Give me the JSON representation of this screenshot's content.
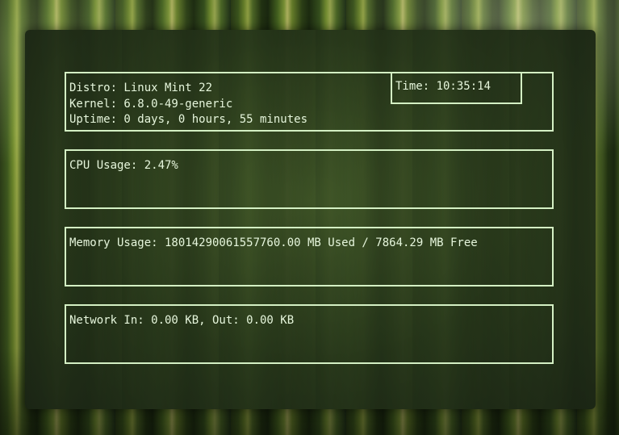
{
  "system": {
    "distro": "Distro: Linux Mint 22",
    "kernel": "Kernel: 6.8.0-49-generic",
    "uptime": "Uptime: 0 days, 0 hours, 55 minutes"
  },
  "clock": {
    "time": "Time: 10:35:14"
  },
  "cpu": {
    "usage": "CPU Usage: 2.47%"
  },
  "memory": {
    "usage": "Memory Usage: 18014290061557760.00 MB Used / 7864.29 MB Free"
  },
  "network": {
    "usage": "Network In: 0.00 KB, Out: 0.00 KB"
  },
  "colors": {
    "text": "#e6f6dc",
    "border": "#d4f0c4",
    "panel": "#2a3a1e"
  }
}
